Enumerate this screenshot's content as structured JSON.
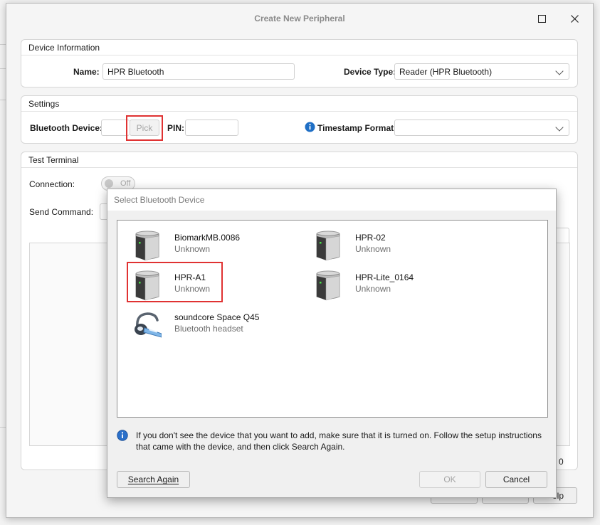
{
  "window": {
    "title": "Create New Peripheral"
  },
  "device_information": {
    "title": "Device Information",
    "name_label": "Name:",
    "name_value": "HPR Bluetooth",
    "device_type_label": "Device Type:",
    "device_type_value": "Reader (HPR Bluetooth)"
  },
  "settings": {
    "title": "Settings",
    "bluetooth_device_label": "Bluetooth Device:",
    "bluetooth_device_value": "",
    "pick_label": "Pick",
    "pin_label": "PIN:",
    "pin_value": "",
    "timestamp_label": "Timestamp Format:",
    "timestamp_value": ""
  },
  "test_terminal": {
    "title": "Test Terminal",
    "connection_label": "Connection:",
    "connection_toggle": "Off",
    "send_command_label": "Send Command:",
    "partial_right_value": "0"
  },
  "bottom_buttons_partial": {
    "help_label": "elp"
  },
  "dialog": {
    "title": "Select Bluetooth Device",
    "devices": [
      {
        "name": "BiomarkMB.0086",
        "status": "Unknown",
        "icon": "reader-device-icon"
      },
      {
        "name": "HPR-02",
        "status": "Unknown",
        "icon": "reader-device-icon"
      },
      {
        "name": "HPR-A1",
        "status": "Unknown",
        "icon": "reader-device-icon"
      },
      {
        "name": "HPR-Lite_0164",
        "status": "Unknown",
        "icon": "reader-device-icon"
      },
      {
        "name": "soundcore Space Q45",
        "status": "Bluetooth headset",
        "icon": "headset-icon"
      }
    ],
    "info_text": "If you don't see the device that you want to add, make sure that it is turned on. Follow the setup instructions that came with the device, and then click Search Again.",
    "search_again_label": "Search Again",
    "ok_label": "OK",
    "cancel_label": "Cancel"
  },
  "colors": {
    "highlight": "#e03232",
    "info_blue": "#1f6fc5"
  }
}
